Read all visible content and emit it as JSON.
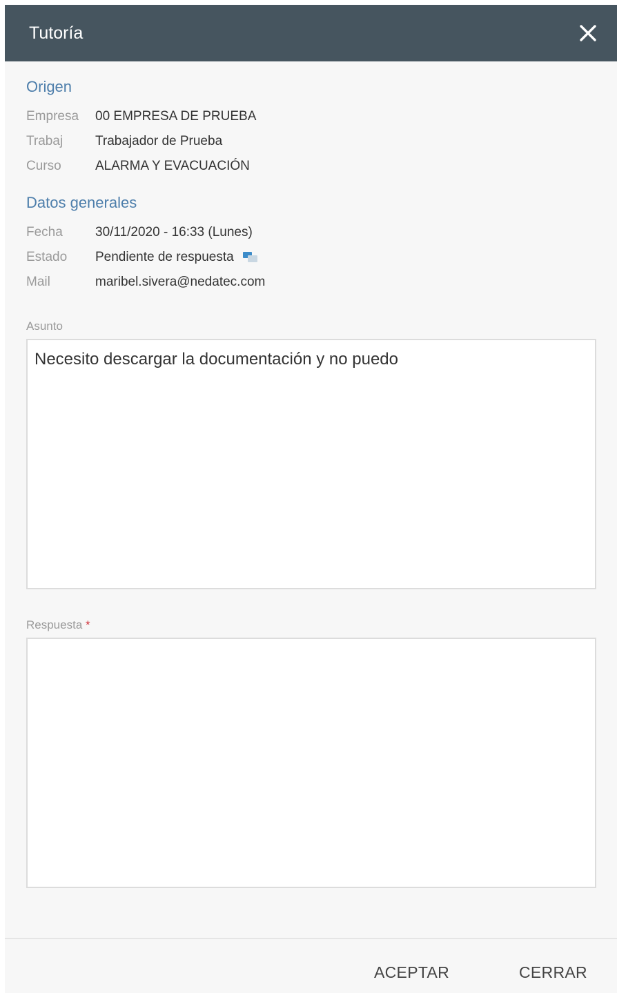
{
  "dialog": {
    "title": "Tutoría"
  },
  "origen": {
    "heading": "Origen",
    "rows": [
      {
        "label": "Empresa",
        "value": "00 EMPRESA DE PRUEBA"
      },
      {
        "label": "Trabaj",
        "value": "Trabajador de Prueba"
      },
      {
        "label": "Curso",
        "value": "ALARMA Y EVACUACIÓN"
      }
    ]
  },
  "datos": {
    "heading": "Datos generales",
    "rows": [
      {
        "label": "Fecha",
        "value": "30/11/2020 - 16:33 (Lunes)"
      },
      {
        "label": "Estado",
        "value": "Pendiente de respuesta"
      },
      {
        "label": "Mail",
        "value": "maribel.sivera@nedatec.com"
      }
    ]
  },
  "asunto": {
    "label": "Asunto",
    "value": "Necesito descargar la documentación y no puedo"
  },
  "respuesta": {
    "label": "Respuesta",
    "required_mark": "*",
    "value": ""
  },
  "footer": {
    "accept_label": "ACEPTAR",
    "close_label": "CERRAR"
  },
  "icons": {
    "close": "close-icon",
    "status": "chat-bubbles-icon"
  },
  "colors": {
    "header_bg": "#46555f",
    "section_title": "#4d7eab",
    "required": "#d0333b"
  }
}
